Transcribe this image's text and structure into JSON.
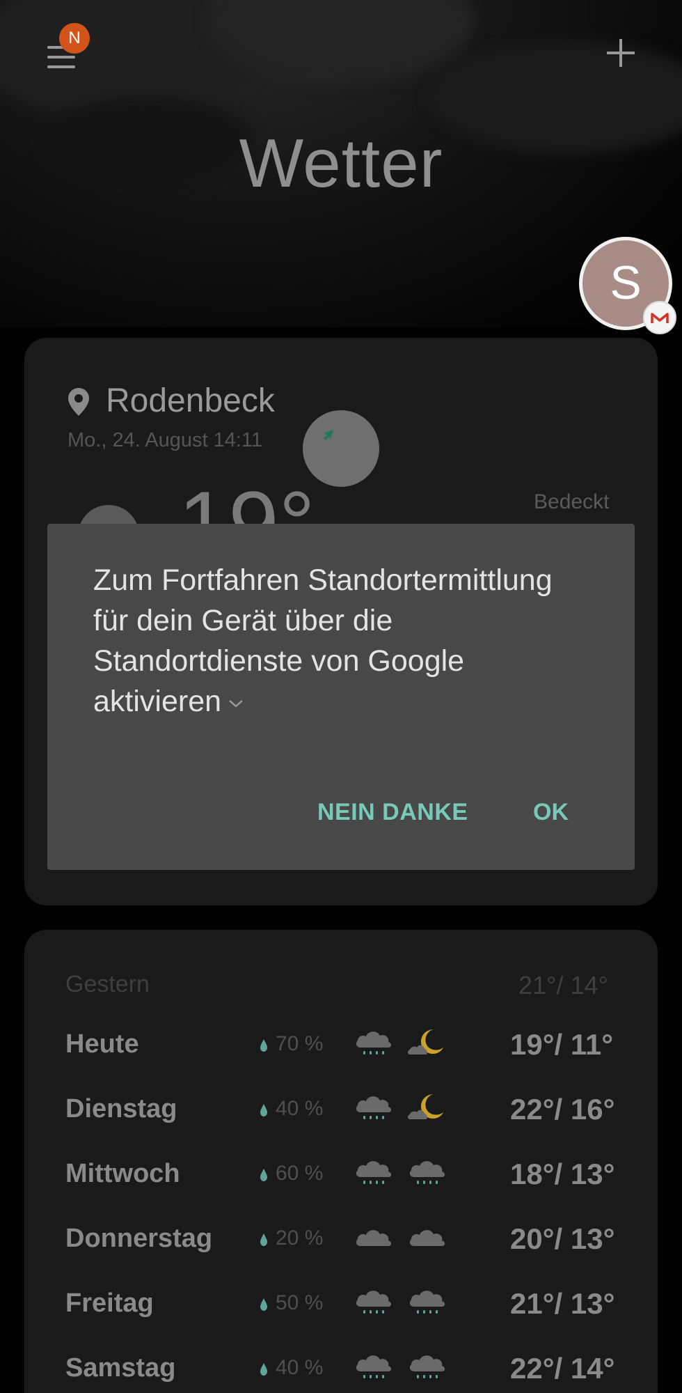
{
  "header": {
    "title": "Wetter",
    "menu_badge": "N",
    "avatar_letter": "S"
  },
  "current": {
    "location": "Rodenbeck",
    "datetime": "Mo., 24. August 14:11",
    "temperature": "19°",
    "condition": "Bedeckt"
  },
  "dialog": {
    "message": "Zum Fortfahren Standortermittlung für dein Gerät über die Standortdienste von Google aktivieren",
    "btn_decline": "NEIN DANKE",
    "btn_accept": "OK"
  },
  "forecast": {
    "yesterday_label": "Gestern",
    "yesterday_temp": "21°/ 14°",
    "days": [
      {
        "name": "Heute",
        "precip": "70 %",
        "range": "19°/ 11°",
        "day_icon": "rain-cloud-icon",
        "night_icon": "cloud-moon-icon"
      },
      {
        "name": "Dienstag",
        "precip": "40 %",
        "range": "22°/ 16°",
        "day_icon": "rain-cloud-icon",
        "night_icon": "cloud-moon-icon"
      },
      {
        "name": "Mittwoch",
        "precip": "60 %",
        "range": "18°/ 13°",
        "day_icon": "rain-cloud-icon",
        "night_icon": "rain-cloud-icon"
      },
      {
        "name": "Donnerstag",
        "precip": "20 %",
        "range": "20°/ 13°",
        "day_icon": "cloud-icon",
        "night_icon": "cloud-icon"
      },
      {
        "name": "Freitag",
        "precip": "50 %",
        "range": "21°/ 13°",
        "day_icon": "rain-cloud-icon",
        "night_icon": "rain-cloud-icon"
      },
      {
        "name": "Samstag",
        "precip": "40 %",
        "range": "22°/ 14°",
        "day_icon": "rain-cloud-icon",
        "night_icon": "rain-cloud-icon"
      }
    ]
  },
  "colors": {
    "accent": "#79c9b8",
    "badge": "#d2541a",
    "moon": "#c9a227",
    "drop": "#5fa59a"
  }
}
